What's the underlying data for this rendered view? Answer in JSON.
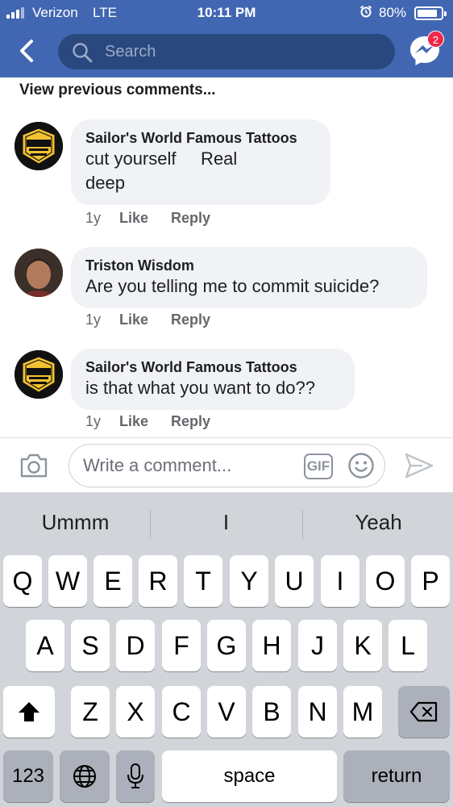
{
  "status_bar": {
    "carrier": "Verizon",
    "network": "LTE",
    "time": "10:11 PM",
    "battery": "80%"
  },
  "nav": {
    "search_placeholder": "Search",
    "messenger_badge": "2"
  },
  "comments_header": "View previous comments...",
  "comments": [
    {
      "author": "Sailor's World Famous Tattoos",
      "text": "cut yourself     Real\ndeep",
      "time": "1y",
      "like": "Like",
      "reply": "Reply"
    },
    {
      "author": "Triston Wisdom",
      "text": "Are you telling me to commit suicide?",
      "time": "1y",
      "like": "Like",
      "reply": "Reply"
    },
    {
      "author": "Sailor's World Famous Tattoos",
      "text": "is that what you want to do??",
      "time": "1y",
      "like": "Like",
      "reply": "Reply"
    }
  ],
  "composer": {
    "placeholder": "Write a comment...",
    "gif_label": "GIF"
  },
  "keyboard": {
    "suggestions": [
      "Ummm",
      "I",
      "Yeah"
    ],
    "row1": [
      "Q",
      "W",
      "E",
      "R",
      "T",
      "Y",
      "U",
      "I",
      "O",
      "P"
    ],
    "row2": [
      "A",
      "S",
      "D",
      "F",
      "G",
      "H",
      "J",
      "K",
      "L"
    ],
    "row3": [
      "Z",
      "X",
      "C",
      "V",
      "B",
      "N",
      "M"
    ],
    "numbers": "123",
    "space": "space",
    "return": "return"
  },
  "colors": {
    "header": "#4267b2",
    "search": "#29487d",
    "bubble": "#f0f2f5",
    "badge": "#f02849",
    "keyboard": "#d1d4d9"
  }
}
